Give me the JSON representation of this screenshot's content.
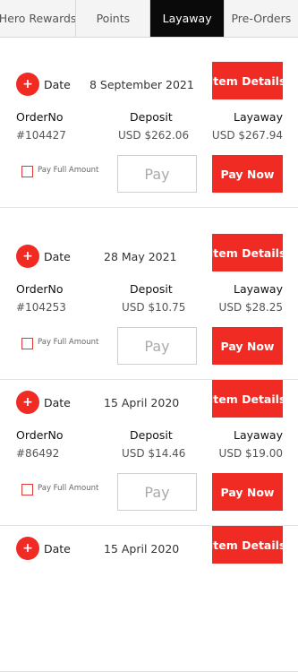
{
  "tabs": [
    {
      "label": "Hero Rewards",
      "active": false
    },
    {
      "label": "Points",
      "active": false
    },
    {
      "label": "Layaway",
      "active": true
    },
    {
      "label": "Pre-Orders",
      "active": false
    }
  ],
  "labels": {
    "date": "Date",
    "item_details": "Item Details",
    "order_no": "OrderNo",
    "deposit": "Deposit",
    "layaway": "Layaway",
    "pay_full_amount": "Pay Full Amount",
    "pay_placeholder": "Pay",
    "pay_now": "Pay Now",
    "plus_icon_glyph": "+"
  },
  "orders": [
    {
      "date": "8 September 2021",
      "order_no": "#104427",
      "deposit": "USD $262.06",
      "layaway": "USD $267.94"
    },
    {
      "date": "28 May 2021",
      "order_no": "#104253",
      "deposit": "USD $10.75",
      "layaway": "USD $28.25"
    },
    {
      "date": "15 April 2020",
      "order_no": "#86492",
      "deposit": "USD $14.46",
      "layaway": "USD $19.00"
    },
    {
      "date": "15 April 2020"
    }
  ],
  "colors": {
    "accent": "#ef2b24",
    "active_tab_bg": "#0a0a0a"
  }
}
